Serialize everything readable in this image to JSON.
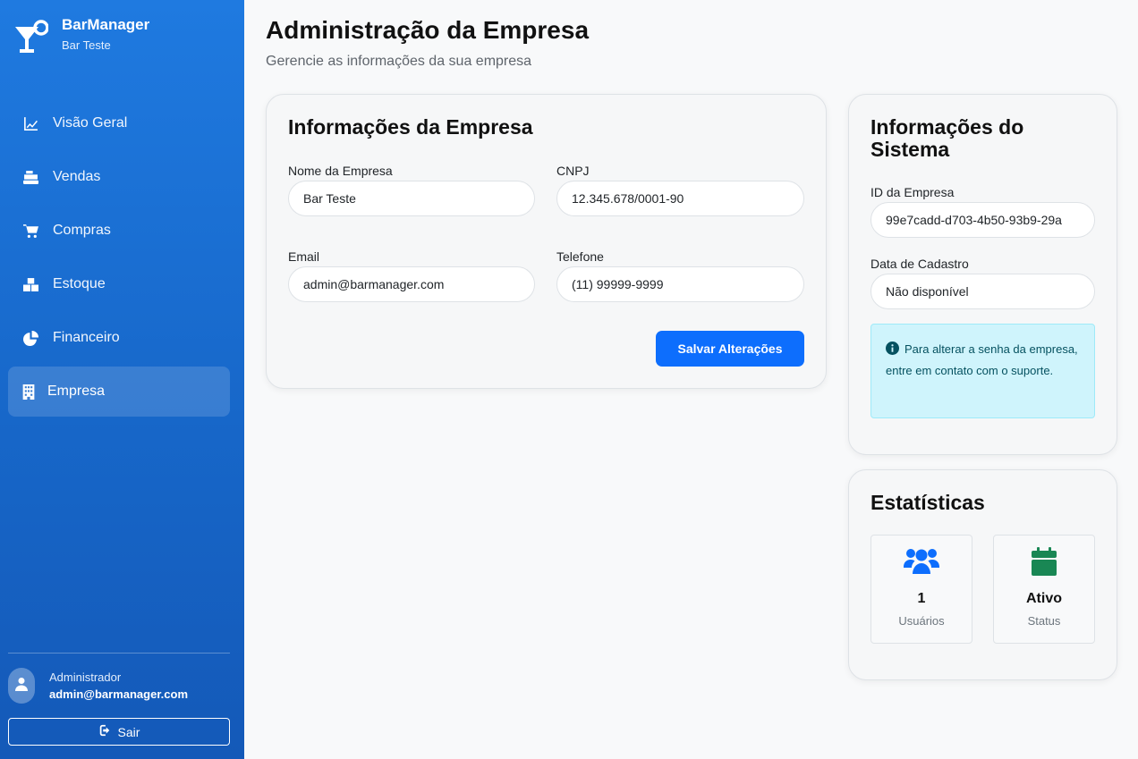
{
  "sidebar": {
    "brand_title": "BarManager",
    "brand_subtitle": "Bar Teste",
    "items": [
      {
        "label": "Visão Geral",
        "icon": "chart-line-icon"
      },
      {
        "label": "Vendas",
        "icon": "cash-register-icon"
      },
      {
        "label": "Compras",
        "icon": "shopping-cart-icon"
      },
      {
        "label": "Estoque",
        "icon": "boxes-icon"
      },
      {
        "label": "Financeiro",
        "icon": "pie-chart-icon"
      },
      {
        "label": "Empresa",
        "icon": "building-icon",
        "active": true
      }
    ],
    "user_role": "Administrador",
    "user_email": "admin@barmanager.com",
    "logout_label": "Sair"
  },
  "page": {
    "title": "Administração da Empresa",
    "subtitle": "Gerencie as informações da sua empresa"
  },
  "company_info": {
    "title": "Informações da Empresa",
    "name_label": "Nome da Empresa",
    "name_value": "Bar Teste",
    "cnpj_label": "CNPJ",
    "cnpj_value": "12.345.678/0001-90",
    "email_label": "Email",
    "email_value": "admin@barmanager.com",
    "phone_label": "Telefone",
    "phone_value": "(11) 99999-9999",
    "save_label": "Salvar Alterações"
  },
  "system_info": {
    "title": "Informações do Sistema",
    "id_label": "ID da Empresa",
    "id_value": "99e7cadd-d703-4b50-93b9-29a",
    "date_label": "Data de Cadastro",
    "date_value": "Não disponível",
    "alert_text": "Para alterar a senha da empresa, entre em contato com o suporte."
  },
  "stats": {
    "title": "Estatísticas",
    "users_value": "1",
    "users_label": "Usuários",
    "status_value": "Ativo",
    "status_label": "Status"
  },
  "colors": {
    "primary": "#0d6efd",
    "sidebar": "#1767c9",
    "success": "#198754",
    "info_bg": "#cff4fc"
  }
}
